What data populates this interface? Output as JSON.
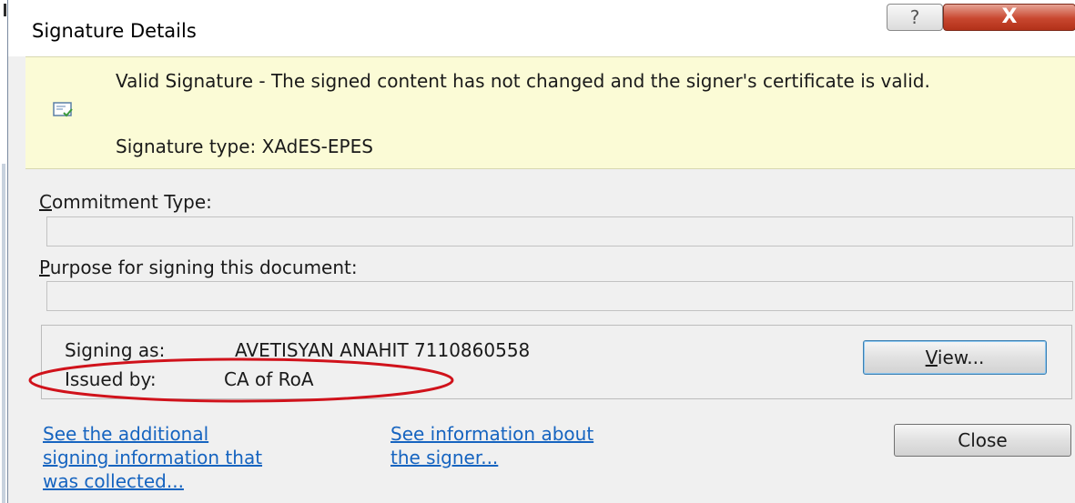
{
  "window": {
    "title": "Signature Details",
    "help_label": "?",
    "close_label": "X"
  },
  "status": {
    "message": "Valid Signature - The signed content has not changed and the signer's certificate is valid.",
    "signature_type": "Signature type: XAdES-EPES",
    "icon": "certificate-check-icon"
  },
  "commitment": {
    "label_accel": "C",
    "label_rest": "ommitment Type:",
    "value": ""
  },
  "purpose": {
    "label_accel": "P",
    "label_rest": "urpose for signing this document:",
    "value": ""
  },
  "signer": {
    "signing_as_label": "Signing as:",
    "signing_as_value": "AVETISYAN ANAHIT 7110860558",
    "issued_by_label": "Issued by:",
    "issued_by_value": "CA of RoA"
  },
  "buttons": {
    "view_accel": "V",
    "view_rest": "iew...",
    "close": "Close"
  },
  "links": {
    "additional_info": [
      "See the additional",
      "signing information that",
      "was collected..."
    ],
    "signer_info": [
      "See information about",
      "the signer..."
    ]
  },
  "annotation": {
    "ellipse_color": "#d0121b"
  },
  "colors": {
    "infobar_bg": "#fbfbd6",
    "link": "#1664c0",
    "close_button": "#c8472f"
  }
}
